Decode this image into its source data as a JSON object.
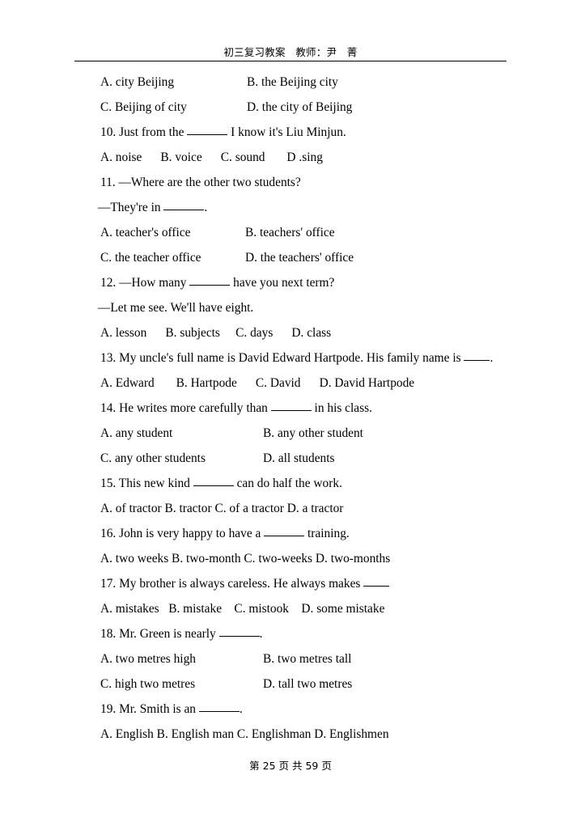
{
  "document": {
    "header": {
      "title": "初三复习教案　教师：尹　菁"
    },
    "footer": {
      "page_label": "第 25 页 共 59 页"
    },
    "lines": [
      {
        "id": "l1",
        "left": "A. city Beijing",
        "right": "B. the Beijing city"
      },
      {
        "id": "l2",
        "left": "C. Beijing of city",
        "right": "D. the city of Beijing"
      },
      {
        "id": "l3",
        "pre": "10. Just from the ",
        "post": " I know it's Liu Minjun."
      },
      {
        "id": "l4",
        "full": "A. noise      B. voice      C. sound       D .sing"
      },
      {
        "id": "l5",
        "full": "11. —Where are the other two students?"
      },
      {
        "id": "l6",
        "pre": "—They're in ",
        "post": "."
      },
      {
        "id": "l7",
        "left": "A. teacher's office",
        "right": "B. teachers' office"
      },
      {
        "id": "l8",
        "left": "C. the teacher office",
        "right": "D. the teachers' office"
      },
      {
        "id": "l9",
        "pre": "12. —How many ",
        "post": " have you next term?"
      },
      {
        "id": "l10",
        "full": "—Let me see. We'll have eight."
      },
      {
        "id": "l11",
        "full": "A. lesson      B. subjects     C. days      D. class"
      },
      {
        "id": "l12",
        "pre": "13. My uncle's full name is David Edward Hartpode. His family name is ",
        "post": "."
      },
      {
        "id": "l13",
        "full": "A. Edward       B. Hartpode      C. David      D. David Hartpode"
      },
      {
        "id": "l14",
        "pre": "14. He writes more carefully than ",
        "post": " in his class."
      },
      {
        "id": "l15",
        "left": "A. any student",
        "right": "B. any other student"
      },
      {
        "id": "l16",
        "left": "C. any other students",
        "right": "D. all students"
      },
      {
        "id": "l17",
        "pre": "15. This new kind ",
        "post": " can do half the work."
      },
      {
        "id": "l18",
        "full": "A. of tractor B. tractor C. of a tractor D. a tractor"
      },
      {
        "id": "l19",
        "pre": "16. John is very happy to have a ",
        "post": " training."
      },
      {
        "id": "l20",
        "full": "A. two weeks B. two-month C. two-weeks D. two-months"
      },
      {
        "id": "l21",
        "pre": "17. My brother is always careless. He always makes ",
        "post": ""
      },
      {
        "id": "l22",
        "full": "A. mistakes   B. mistake    C. mistook    D. some mistake"
      },
      {
        "id": "l23",
        "pre": "18. Mr. Green is nearly ",
        "post": "."
      },
      {
        "id": "l24",
        "left": "A. two metres high",
        "right": "B. two metres tall"
      },
      {
        "id": "l25",
        "left": "C. high two metres",
        "right": "D. tall two metres"
      },
      {
        "id": "l26",
        "pre": "19. Mr. Smith is an ",
        "post": "."
      },
      {
        "id": "l27",
        "full": "A. English B. English man C. Englishman D. Englishmen"
      }
    ]
  }
}
